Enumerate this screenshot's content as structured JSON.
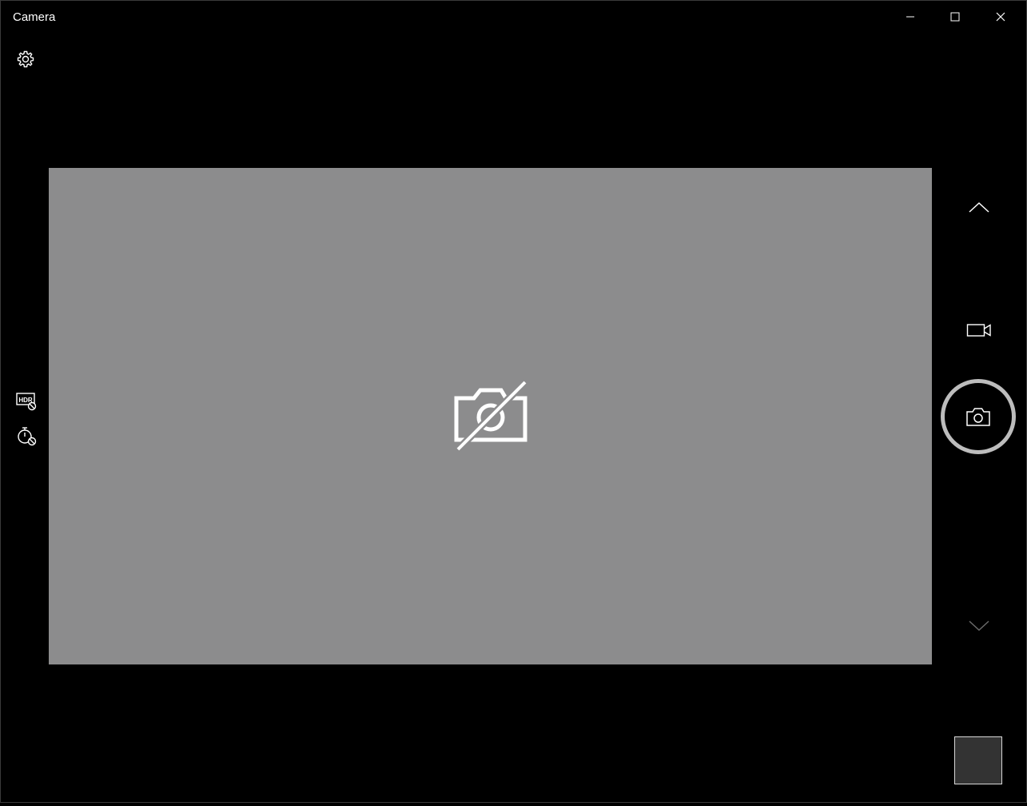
{
  "window": {
    "title": "Camera"
  },
  "icons": {
    "settings": "gear-icon",
    "minimize": "minimize-icon",
    "maximize": "maximize-icon",
    "close": "close-icon",
    "camera_unavailable": "camera-off-icon",
    "hdr": "hdr-off-icon",
    "timer": "timer-off-icon",
    "mode_up": "chevron-up-icon",
    "video_mode": "video-camera-icon",
    "take_photo": "camera-icon",
    "mode_down": "chevron-down-icon"
  },
  "colors": {
    "background": "#000000",
    "preview": "#8c8c8d",
    "foreground": "#ffffff",
    "capture_ring": "#bdbdbd",
    "thumbnail": "#333333"
  }
}
